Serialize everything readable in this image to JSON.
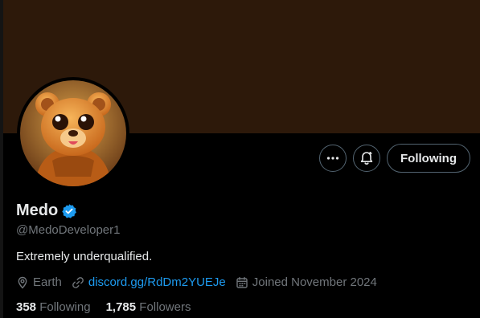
{
  "profile": {
    "display_name": "Medo",
    "handle": "@MedoDeveloper1",
    "bio": "Extremely underqualified.",
    "location": "Earth",
    "website": "discord.gg/RdDm2YUEJe",
    "joined": "Joined November 2024",
    "verified_badge_color": "#1d9bf0",
    "banner_color": "#2d190a"
  },
  "actions": {
    "more_icon": "more-horizontal-icon",
    "notify_icon": "bell-plus-icon",
    "following_label": "Following"
  },
  "stats": {
    "following_count": "358",
    "following_label": "Following",
    "followers_count": "1,785",
    "followers_label": "Followers"
  },
  "meta_icons": {
    "location": "location-pin-icon",
    "website": "link-icon",
    "joined": "calendar-icon"
  }
}
